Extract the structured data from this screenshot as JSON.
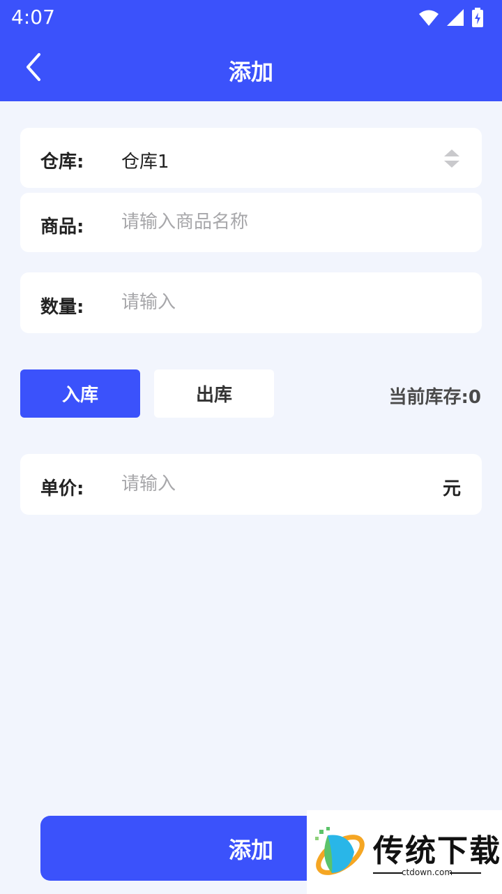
{
  "status_bar": {
    "time": "4:07"
  },
  "header": {
    "title": "添加"
  },
  "form": {
    "warehouse": {
      "label": "仓库:",
      "value": "仓库1"
    },
    "product": {
      "label": "商品:",
      "placeholder": "请输入商品名称"
    },
    "quantity": {
      "label": "数量:",
      "placeholder": "请输入"
    },
    "direction": {
      "in_label": "入库",
      "out_label": "出库",
      "selected": "入库"
    },
    "stock": {
      "label": "当前库存:",
      "value": "0"
    },
    "price": {
      "label": "单价:",
      "placeholder": "请输入",
      "unit": "元"
    }
  },
  "submit": {
    "label": "添加"
  },
  "watermark": {
    "text": "传统下载",
    "site": "ctdown.com"
  },
  "colors": {
    "primary": "#3b52fb",
    "background": "#f2f5fd"
  }
}
